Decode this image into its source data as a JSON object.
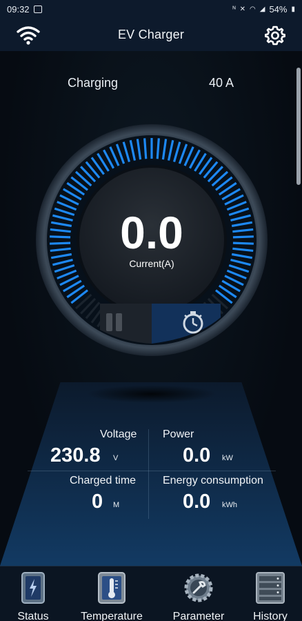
{
  "statusbar": {
    "time": "09:32",
    "battery": "54%"
  },
  "appbar": {
    "title": "EV Charger",
    "left_icon": "wifi-icon",
    "right_icon": "gear-icon"
  },
  "charge": {
    "state": "Charging",
    "current_limit": "40 A"
  },
  "gauge": {
    "value": "0.0",
    "label": "Current(A)",
    "accent": "#1f8fff"
  },
  "metrics": {
    "voltage": {
      "label": "Voltage",
      "value": "230.8",
      "unit": "V"
    },
    "power": {
      "label": "Power",
      "value": "0.0",
      "unit": "kW"
    },
    "charged_time": {
      "label": "Charged time",
      "value": "0",
      "unit": "M"
    },
    "energy": {
      "label": "Energy consumption",
      "value": "0.0",
      "unit": "kWh"
    }
  },
  "tabs": [
    {
      "label": "Status",
      "icon": "battery-icon"
    },
    {
      "label": "Temperature",
      "icon": "thermometer-icon"
    },
    {
      "label": "Parameter",
      "icon": "gear-wrench-icon"
    },
    {
      "label": "History",
      "icon": "list-icon"
    }
  ]
}
